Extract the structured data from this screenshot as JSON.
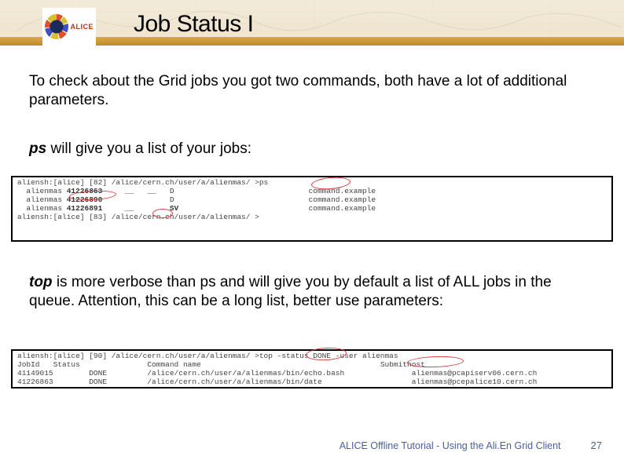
{
  "header": {
    "logo_label": "ALICE",
    "title": "Job Status I"
  },
  "body": {
    "intro": "To check about the Grid jobs you got two commands, both have a lot of additional parameters.",
    "ps_cmd": "ps",
    "ps_text": " will give you a list of your jobs:",
    "top_cmd": "top",
    "top_text": " is more verbose than ps and will give you by default a list of ALL jobs in the queue. Attention, this can be a long list, better use parameters:"
  },
  "terminal1": {
    "line1_pre": "aliensh:[alice] [82] /alice/cern.ch/user/a/alienmas/ >ps",
    "row1_user": "alienmas",
    "row1_id": "41226863",
    "row1_f1": "__",
    "row1_f2": "__",
    "row1_st": "D",
    "row1_cmd": "command.example",
    "row2_user": "alienmas",
    "row2_id": "41226890",
    "row2_st": "D",
    "row2_cmd": "command.example",
    "row3_user": "alienmas",
    "row3_id": "41226891",
    "row3_f1": "__",
    "row3_st": "SV",
    "row3_cmd": "command.example",
    "line_end": "aliensh:[alice] [83] /alice/cern.ch/user/a/alienmas/ >"
  },
  "terminal2": {
    "line1": "aliensh:[alice] [90] /alice/cern.ch/user/a/alienmas/ >top -status DONE -user alienmas",
    "hdr1": "JobId   Status",
    "hdr2": "Command name",
    "hdr3": "Submithost",
    "r1_id": "41149015",
    "r1_st": "DONE",
    "r1_cmd": "/alice/cern.ch/user/a/alienmas/bin/echo.bash",
    "r1_host": "alienmas@pcapiserv06.cern.ch",
    "r2_id": "41226863",
    "r2_st": "DONE",
    "r2_cmd": "/alice/cern.ch/user/a/alienmas/bin/date",
    "r2_host": "alienmas@pcepalice10.cern.ch"
  },
  "footer": {
    "text": "ALICE Offline Tutorial - Using the Ali.En Grid Client",
    "page": "27"
  }
}
